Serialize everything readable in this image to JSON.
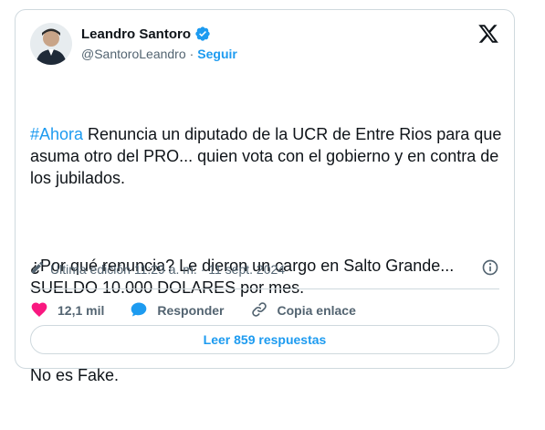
{
  "author": {
    "name": "Leandro Santoro",
    "handle": "@SantoroLeandro",
    "separator": "·",
    "follow_label": "Seguir"
  },
  "tweet": {
    "hashtag": "#Ahora",
    "line1_rest": " Renuncia un diputado de la UCR de Entre Rios para que asuma otro del PRO... quien vota con el gobierno y en contra de los jubilados.",
    "paragraph2": "¿Por qué renuncia? Le dieron un cargo en Salto Grande... SUELDO 10.000 DOLARES por mes.",
    "paragraph3": "No es Fake."
  },
  "edited": {
    "text": "Última edición 11:29 a. m. · 11 sept. 2024"
  },
  "actions": {
    "like_count": "12,1 mil",
    "reply_label": "Responder",
    "copy_label": "Copia enlace"
  },
  "read_replies_label": "Leer 859 respuestas",
  "colors": {
    "accent": "#1d9bf0",
    "like": "#f91880",
    "text": "#0f1419",
    "muted": "#536471",
    "border": "#cfd9de"
  },
  "icons": {
    "avatar": "avatar",
    "verified": "verified-badge-icon",
    "x_logo": "x-logo-icon",
    "pencil": "pencil-icon",
    "info": "info-icon",
    "heart": "heart-icon",
    "reply": "reply-bubble-icon",
    "link": "link-icon"
  }
}
